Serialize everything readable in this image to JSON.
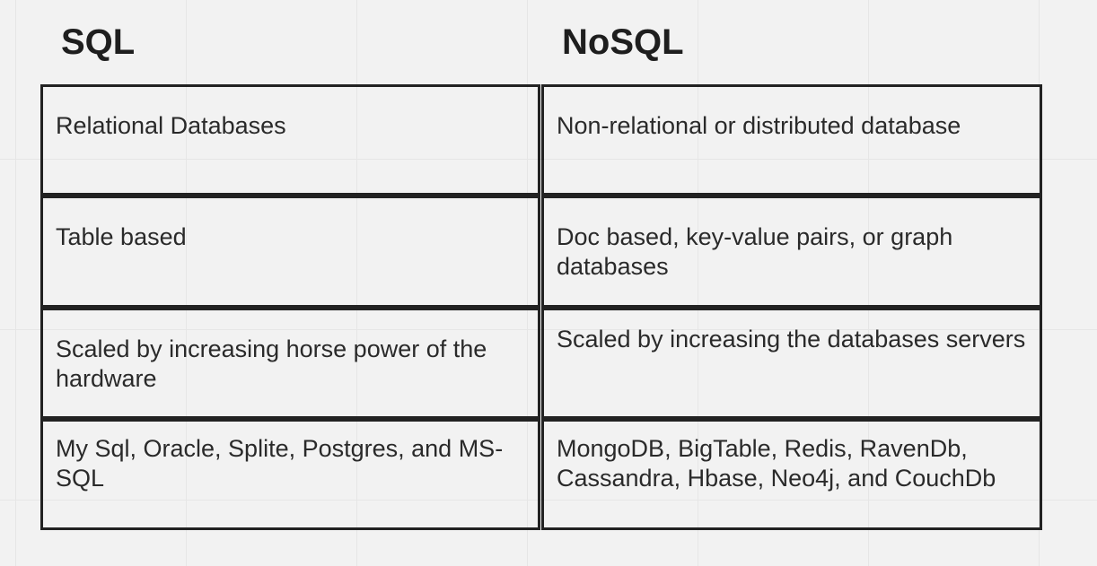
{
  "headings": {
    "left": "SQL",
    "right": "NoSQL"
  },
  "rows": [
    {
      "sql": "Relational Databases",
      "nosql": "Non-relational or distributed database"
    },
    {
      "sql": "Table based",
      "nosql": "Doc based, key-value pairs, or graph databases"
    },
    {
      "sql": "Scaled by increasing horse power of the hardware",
      "nosql": "Scaled by increasing the databases servers"
    },
    {
      "sql": "My Sql, Oracle, Splite, Postgres, and MS-SQL",
      "nosql": "MongoDB, BigTable, Redis, RavenDb, Cassandra, Hbase, Neo4j, and CouchDb"
    }
  ]
}
